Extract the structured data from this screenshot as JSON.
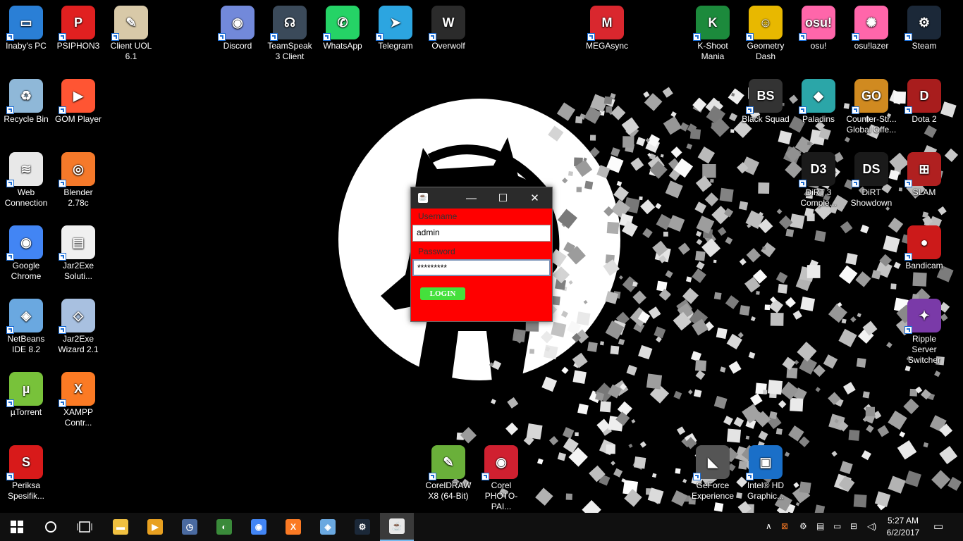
{
  "desktop_icons": [
    {
      "label": "Inaby's PC",
      "color": "#2a7fd6",
      "glyph": "▭"
    },
    {
      "label": "PSIPHON3",
      "color": "#e02020",
      "glyph": "P"
    },
    {
      "label": "Client UOL 6.1",
      "color": "#d8c9a8",
      "glyph": "✎"
    },
    {
      "label": "Discord",
      "color": "#7289da",
      "glyph": "◉"
    },
    {
      "label": "TeamSpeak 3 Client",
      "color": "#3b4a5a",
      "glyph": "☊"
    },
    {
      "label": "WhatsApp",
      "color": "#25d366",
      "glyph": "✆"
    },
    {
      "label": "Telegram",
      "color": "#2ca5e0",
      "glyph": "➤"
    },
    {
      "label": "Overwolf",
      "color": "#2b2b2b",
      "glyph": "W"
    },
    {
      "label": "MEGAsync",
      "color": "#d9272e",
      "glyph": "M"
    },
    {
      "label": "K-Shoot Mania",
      "color": "#1c8a3c",
      "glyph": "K"
    },
    {
      "label": "Geometry Dash",
      "color": "#e8b800",
      "glyph": "☺"
    },
    {
      "label": "osu!",
      "color": "#ff66aa",
      "glyph": "osu!"
    },
    {
      "label": "osu!lazer",
      "color": "#ff66aa",
      "glyph": "✺"
    },
    {
      "label": "Steam",
      "color": "#1b2838",
      "glyph": "⚙"
    },
    {
      "label": "Recycle Bin",
      "color": "#8fb8d8",
      "glyph": "♻"
    },
    {
      "label": "GOM Player",
      "color": "#ff5533",
      "glyph": "▶"
    },
    {
      "label": "Black Squad",
      "color": "#333333",
      "glyph": "BS"
    },
    {
      "label": "Paladins",
      "color": "#2ba6a8",
      "glyph": "◆"
    },
    {
      "label": "Counter-Str... Global Offe...",
      "color": "#d08a20",
      "glyph": "GO"
    },
    {
      "label": "Dota 2",
      "color": "#a81d1d",
      "glyph": "D"
    },
    {
      "label": "Web Connection",
      "color": "#e8e8e8",
      "glyph": "≋"
    },
    {
      "label": "Blender 2.78c",
      "color": "#f5792a",
      "glyph": "◎"
    },
    {
      "label": "DiRT 3 Comple...",
      "color": "#1a1a1a",
      "glyph": "D3"
    },
    {
      "label": "DiRT Showdown",
      "color": "#1a1a1a",
      "glyph": "DS"
    },
    {
      "label": "SLAM",
      "color": "#b02020",
      "glyph": "⊞"
    },
    {
      "label": "Google Chrome",
      "color": "#4285f4",
      "glyph": "◉"
    },
    {
      "label": "Jar2Exe Soluti...",
      "color": "#f0f0f0",
      "glyph": "▤"
    },
    {
      "label": "Bandicam",
      "color": "#cc1a1a",
      "glyph": "●"
    },
    {
      "label": "NetBeans IDE 8.2",
      "color": "#6aa8e0",
      "glyph": "◈"
    },
    {
      "label": "Jar2Exe Wizard 2.1",
      "color": "#a8c0e0",
      "glyph": "◇"
    },
    {
      "label": "Ripple Server Switcher",
      "color": "#7a3aa8",
      "glyph": "✦"
    },
    {
      "label": "µTorrent",
      "color": "#78c23a",
      "glyph": "µ"
    },
    {
      "label": "XAMPP Contr...",
      "color": "#fb7a24",
      "glyph": "X"
    },
    {
      "label": "CorelDRAW X8 (64-Bit)",
      "color": "#6ab03a",
      "glyph": "✎"
    },
    {
      "label": "Corel PHOTO-PAI...",
      "color": "#d02030",
      "glyph": "◉"
    },
    {
      "label": "GeForce Experience",
      "color": "#555555",
      "glyph": "◣"
    },
    {
      "label": "Intel® HD Graphic...",
      "color": "#1a6fc8",
      "glyph": "▣"
    },
    {
      "label": "Periksa Spesifik...",
      "color": "#d81a1a",
      "glyph": "S"
    }
  ],
  "login_window": {
    "username_label": "Username",
    "username_value": "admin",
    "password_label": "Password",
    "password_value": "*********",
    "login_button": "LOGIN",
    "minimize": "—",
    "maximize": "☐",
    "close": "✕"
  },
  "taskbar": {
    "items": [
      {
        "name": "file-explorer",
        "color": "#f0c040",
        "glyph": "▬"
      },
      {
        "name": "media-player",
        "color": "#e8a020",
        "glyph": "▶"
      },
      {
        "name": "clock-app",
        "color": "#4a6aa0",
        "glyph": "◷"
      },
      {
        "name": "globe-app",
        "color": "#3a8a3a",
        "glyph": "◐"
      },
      {
        "name": "chrome",
        "color": "#4285f4",
        "glyph": "◉"
      },
      {
        "name": "xampp",
        "color": "#fb7a24",
        "glyph": "X"
      },
      {
        "name": "netbeans",
        "color": "#6aa8e0",
        "glyph": "◈"
      },
      {
        "name": "steam",
        "color": "#1b2838",
        "glyph": "⚙"
      },
      {
        "name": "java",
        "color": "#e8e8e8",
        "glyph": "☕"
      }
    ],
    "time": "5:27 AM",
    "date": "6/2/2017",
    "tray_chevron": "∧"
  }
}
